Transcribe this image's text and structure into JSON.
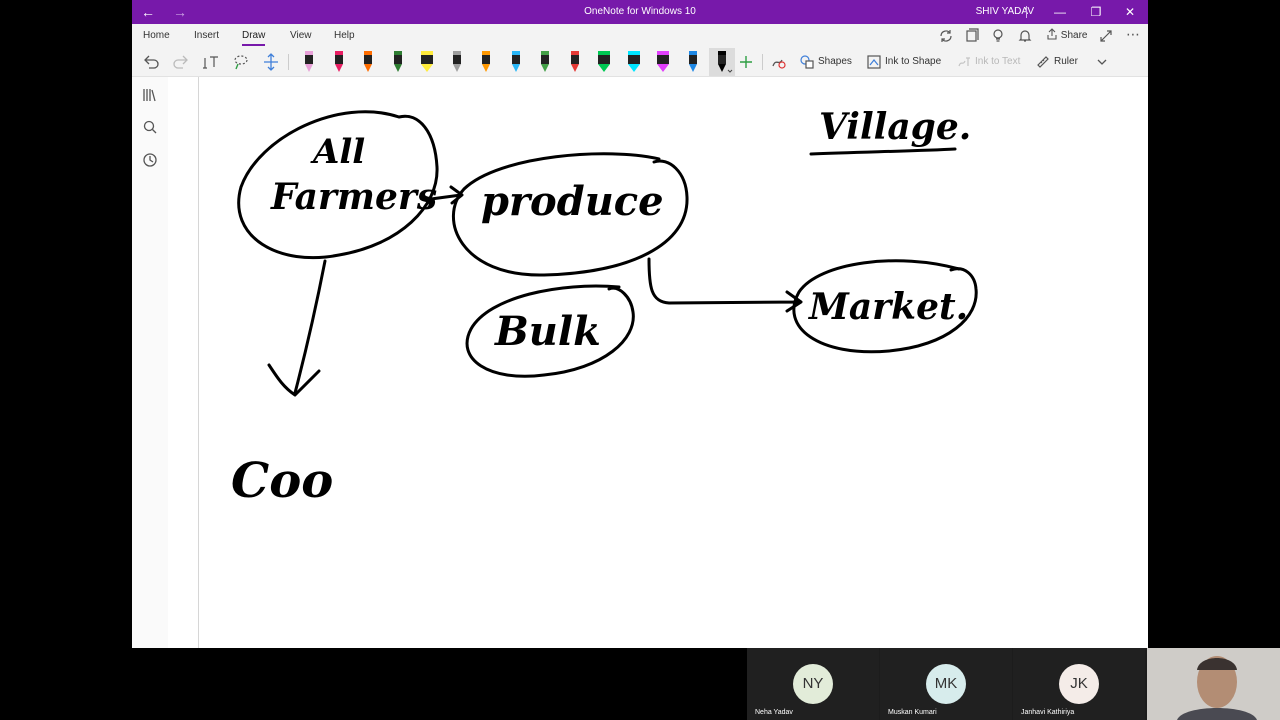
{
  "window": {
    "title": "OneNote for Windows 10",
    "user": "SHIV YADAV",
    "accent": "#7719aa"
  },
  "ribbon": {
    "tabs": [
      {
        "label": "Home"
      },
      {
        "label": "Insert"
      },
      {
        "label": "Draw",
        "active": true
      },
      {
        "label": "View"
      },
      {
        "label": "Help"
      }
    ],
    "share_label": "Share"
  },
  "toolbar": {
    "pens": [
      {
        "color": "#e8a0d8"
      },
      {
        "color": "#e91e63"
      },
      {
        "color": "#ff6d00"
      },
      {
        "color": "#2e7d32"
      },
      {
        "color": "#ffeb3b",
        "highlighter": true
      },
      {
        "color": "#9e9e9e"
      },
      {
        "color": "#ff9800"
      },
      {
        "color": "#29b6f6"
      },
      {
        "color": "#43a047"
      },
      {
        "color": "#e53935"
      },
      {
        "color": "#00c853",
        "highlighter": true
      },
      {
        "color": "#00e5ff",
        "highlighter": true
      },
      {
        "color": "#e040fb",
        "highlighter": true
      },
      {
        "color": "#1e88e5"
      },
      {
        "color": "#000000",
        "selected": true
      }
    ],
    "shapes_label": "Shapes",
    "ink_to_shape_label": "Ink to Shape",
    "ink_to_text_label": "Ink to Text",
    "ruler_label": "Ruler"
  },
  "canvas": {
    "ink_color": "#000000",
    "handwriting": [
      "All",
      "Farmers",
      "produce",
      "Bulk",
      "Market.",
      "Village.",
      "Coo"
    ]
  },
  "participants": [
    {
      "initials": "NY",
      "name": "Neha Yadav",
      "color": "#e2ecd9"
    },
    {
      "initials": "MK",
      "name": "Muskan Kumari",
      "color": "#d7ecec"
    },
    {
      "initials": "JK",
      "name": "Janhavi Kathiriya",
      "color": "#f4ece8"
    }
  ]
}
